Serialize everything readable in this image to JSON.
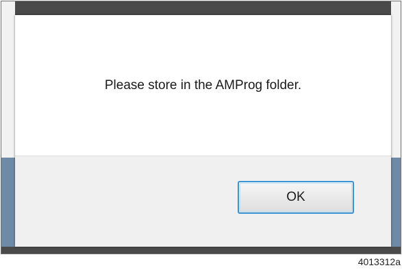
{
  "dialog": {
    "message": "Please store in the AMProg folder.",
    "ok_label": "OK"
  },
  "figure_id": "4013312a"
}
